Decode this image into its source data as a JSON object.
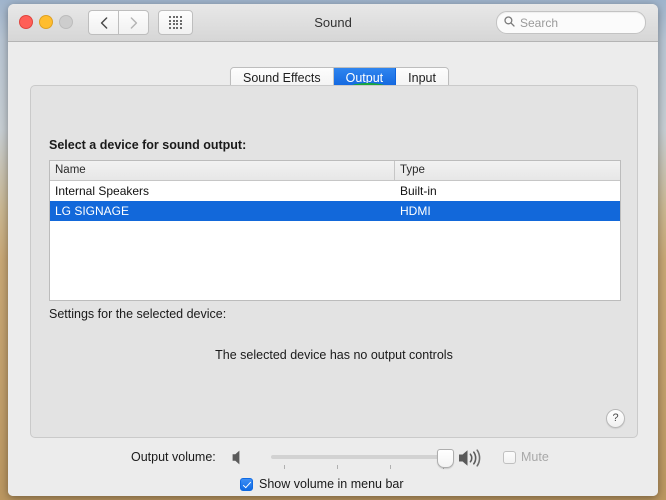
{
  "window": {
    "title": "Sound",
    "traffic_lights": [
      "close",
      "minimize",
      "zoom"
    ],
    "nav": {
      "back_icon": "chevron-left-icon",
      "forward_icon": "chevron-right-icon"
    },
    "grid_icon": "show-all-grid-icon"
  },
  "search": {
    "placeholder": "Search",
    "value": "",
    "icon": "search-icon"
  },
  "tabs": [
    {
      "label": "Sound Effects",
      "selected": false
    },
    {
      "label": "Output",
      "selected": true
    },
    {
      "label": "Input",
      "selected": false
    }
  ],
  "annotation": {
    "shape": "ellipse",
    "color": "#19a63a",
    "target": "Output"
  },
  "panel": {
    "heading": "Select a device for sound output:",
    "table": {
      "columns": [
        "Name",
        "Type"
      ],
      "rows": [
        {
          "name": "Internal Speakers",
          "type": "Built-in",
          "selected": false
        },
        {
          "name": "LG SIGNAGE",
          "type": "HDMI",
          "selected": true
        }
      ]
    },
    "settings_label": "Settings for the selected device:",
    "no_controls_message": "The selected device has no output controls",
    "help_label": "?"
  },
  "volume": {
    "label": "Output volume:",
    "low_icon": "speaker-mute-icon",
    "high_icon": "speaker-loud-icon",
    "slider_percent": 93,
    "tick_count": 4,
    "mute": {
      "label": "Mute",
      "checked": false,
      "enabled": false
    },
    "menu_bar": {
      "label": "Show volume in menu bar",
      "checked": true
    }
  },
  "colors": {
    "selection_blue": "#1268da",
    "annotation_green": "#19a63a",
    "window_chrome": "#ececec"
  }
}
